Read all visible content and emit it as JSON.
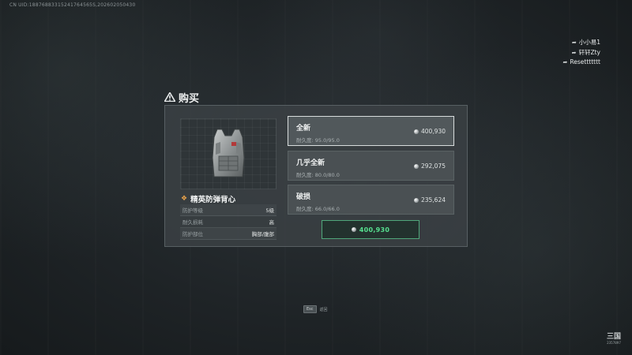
{
  "uid_text": "CN UID:18876883315241764565S,202602050430",
  "players": [
    {
      "name": "小小易1",
      "icon": "arrow-icon"
    },
    {
      "name": "轩轩Zty",
      "icon": "arrow-icon"
    },
    {
      "name": "Resettttttt",
      "icon": "arrow-icon"
    }
  ],
  "dialog": {
    "title": "购买",
    "title_icon": "warning-triangle-icon"
  },
  "item": {
    "name": "精英防弹背心",
    "rank_icon": "rank-diamond-icon",
    "stats": [
      {
        "key": "防护等级",
        "value": "5级"
      },
      {
        "key": "耐久损耗",
        "value": "高"
      },
      {
        "key": "防护部位",
        "value": "胸部/腹部"
      }
    ]
  },
  "options": [
    {
      "condition": "全新",
      "durability": "耐久度: 95.0/95.0",
      "price": "400,930",
      "selected": true
    },
    {
      "condition": "几乎全新",
      "durability": "耐久度: 80.0/80.0",
      "price": "292,075",
      "selected": false
    },
    {
      "condition": "破损",
      "durability": "耐久度: 66.0/66.0",
      "price": "235,624",
      "selected": false
    }
  ],
  "buy_button": {
    "price": "400,930",
    "color": "#56e08f"
  },
  "esc_hint": {
    "key": "Esc",
    "label": "返回"
  },
  "watermark": {
    "top": "三国",
    "bottom": "2357897"
  }
}
